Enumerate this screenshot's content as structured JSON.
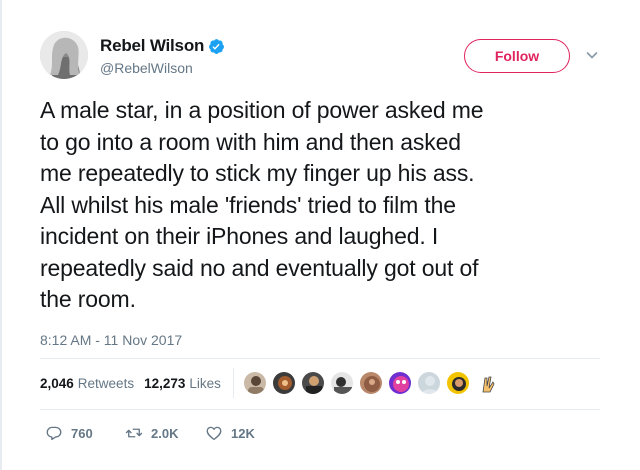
{
  "user": {
    "display_name": "Rebel Wilson",
    "handle": "@RebelWilson",
    "verified": true
  },
  "header": {
    "follow_label": "Follow"
  },
  "tweet": {
    "lines": [
      "A male star, in a position of power asked me",
      "to go into a room with him and then asked",
      "me repeatedly to stick my finger up his ass.",
      "All whilst his male 'friends' tried to film the",
      "incident on their iPhones and laughed. I",
      "repeatedly said no and eventually got out of",
      "the room."
    ],
    "timestamp": "8:12 AM - 11 Nov 2017"
  },
  "stats": {
    "retweets_count": "2,046",
    "retweets_label": "Retweets",
    "likes_count": "12,273",
    "likes_label": "Likes"
  },
  "actions": {
    "reply_count": "760",
    "retweet_count": "2.0K",
    "like_count": "12K"
  },
  "colors": {
    "accent": "#e0245e",
    "verified": "#1da1f2",
    "muted": "#657786",
    "text": "#14171a"
  },
  "icons": [
    "verified-badge-icon",
    "chevron-down-icon",
    "reply-icon",
    "retweet-icon",
    "heart-icon"
  ]
}
